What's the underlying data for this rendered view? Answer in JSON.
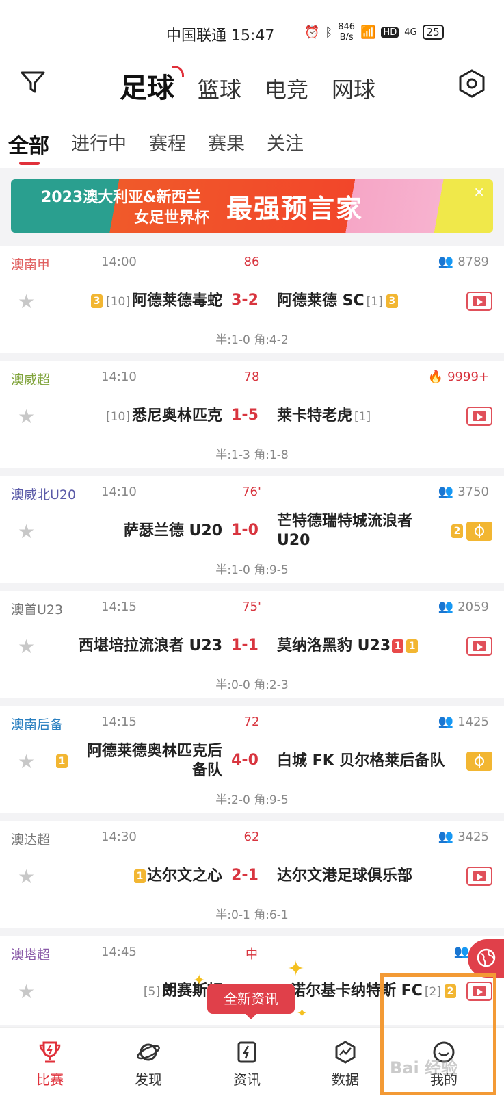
{
  "status_bar": {
    "carrier_time": "中国联通 15:47",
    "net_speed": "846",
    "net_unit": "B/s",
    "hd": "HD",
    "signal": "4G",
    "battery": "25"
  },
  "sport_tabs": [
    "足球",
    "篮球",
    "电竞",
    "网球"
  ],
  "sub_tabs": [
    "全部",
    "进行中",
    "赛程",
    "赛果",
    "关注"
  ],
  "banner": {
    "line1": "2023澳大利亚&新西兰",
    "line2": "女足世界杯",
    "headline": "最强预言家",
    "close": "×"
  },
  "matches": [
    {
      "league": "澳南甲",
      "league_color": "#e06060",
      "time": "14:00",
      "minute": "86",
      "count": "8789",
      "home": "阿德莱德毒蛇",
      "home_rank": "[10]",
      "score": "3-2",
      "away": "阿德莱德 SC",
      "away_rank": "[1]",
      "half": "半:1-0   角:4-2"
    },
    {
      "league": "澳威超",
      "league_color": "#7fa33a",
      "time": "14:10",
      "minute": "78",
      "count": "9999+",
      "home": "悉尼奥林匹克",
      "home_rank": "[10]",
      "score": "1-5",
      "away": "莱卡特老虎",
      "away_rank": "[1]",
      "half": "半:1-3   角:1-8"
    },
    {
      "league": "澳威北U20",
      "league_color": "#5a5aa8",
      "time": "14:10",
      "minute": "76'",
      "count": "3750",
      "home": "萨瑟兰德 U20",
      "home_rank": "",
      "score": "1-0",
      "away": "芒特德瑞特城流浪者 U20",
      "away_rank": "",
      "half": "半:1-0   角:9-5"
    },
    {
      "league": "澳首U23",
      "league_color": "#777777",
      "time": "14:15",
      "minute": "75'",
      "count": "2059",
      "home": "西堪培拉流浪者 U23",
      "home_rank": "",
      "score": "1-1",
      "away": "莫纳洛黑豹 U23",
      "away_rank": "",
      "half": "半:0-0   角:2-3"
    },
    {
      "league": "澳南后备",
      "league_color": "#2a7fc0",
      "time": "14:15",
      "minute": "72",
      "count": "1425",
      "home": "阿德莱德奥林匹克后备队",
      "home_rank": "",
      "score": "4-0",
      "away": "白城 FK 贝尔格莱后备队",
      "away_rank": "",
      "half": "半:2-0   角:9-5"
    },
    {
      "league": "澳达超",
      "league_color": "#777777",
      "time": "14:30",
      "minute": "62",
      "count": "3425",
      "home": "达尔文之心",
      "home_rank": "",
      "score": "2-1",
      "away": "达尔文港足球俱乐部",
      "away_rank": "",
      "half": "半:0-1   角:6-1"
    },
    {
      "league": "澳塔超",
      "league_color": "#8a5aa8",
      "time": "14:45",
      "minute": "中",
      "count": "87",
      "home": "朗赛斯顿",
      "home_rank": "[5]",
      "score": "",
      "away": "诺尔基卡纳特斯 FC",
      "away_rank": "[2]",
      "half": ""
    }
  ],
  "card_labels": {
    "c1": "1",
    "c2": "2",
    "c3": "3"
  },
  "news_pill": "全新资讯",
  "bottom_nav": [
    "比赛",
    "发现",
    "资讯",
    "数据",
    "我的"
  ],
  "watermark": "Bai 经验",
  "colors": {
    "accent": "#e0303a",
    "live_score": "#d8353f",
    "card_yellow": "#f2b632",
    "card_red": "#e84a4a",
    "highlight": "#f39a35"
  }
}
